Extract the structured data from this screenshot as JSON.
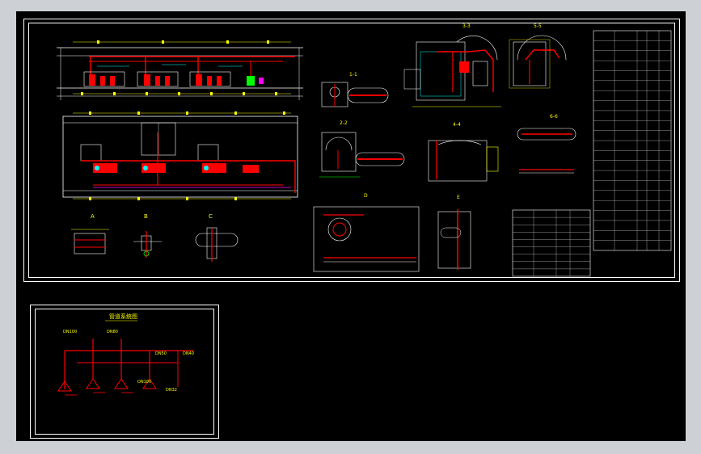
{
  "drawing": {
    "main_sheet": {
      "section_labels": [
        "1-1",
        "2-2",
        "3-3",
        "4-4",
        "5-5",
        "6-6",
        "A",
        "B",
        "C",
        "D"
      ],
      "table_rows": 22,
      "table_cols": 5
    },
    "pipe_diagram": {
      "title": "管道系统图",
      "annotations": [
        "DN100",
        "DN80",
        "DN50",
        "DN40",
        "DN100",
        "DN32"
      ]
    }
  },
  "colors": {
    "background": "#000000",
    "pipe": "#ff0000",
    "dimension": "#ffff00",
    "detail": "#00ffff",
    "equipment": "#00ff00",
    "frame": "#ffffff",
    "window_bg": "#cdd0d4"
  }
}
